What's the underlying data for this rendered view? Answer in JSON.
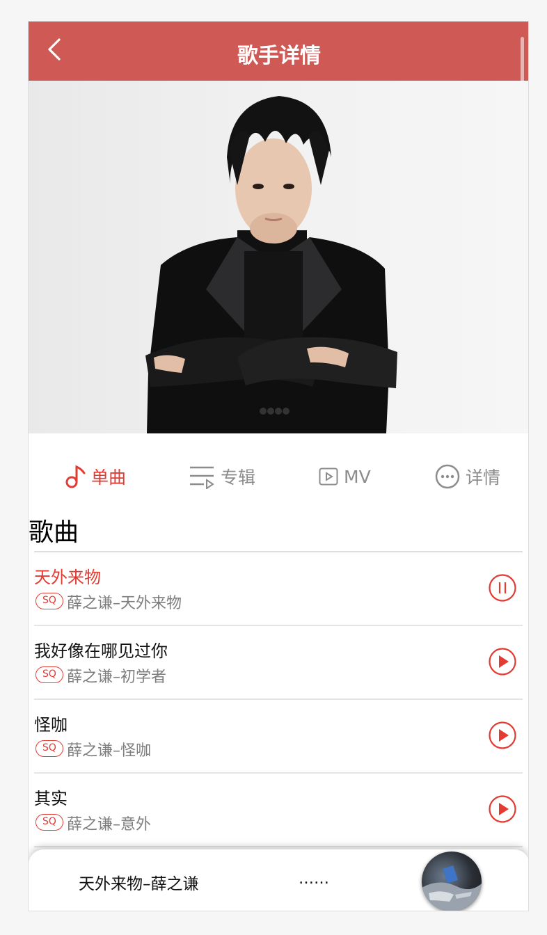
{
  "header": {
    "title": "歌手详情"
  },
  "tabs": [
    {
      "label": "单曲",
      "icon": "music-note-icon",
      "active": true
    },
    {
      "label": "专辑",
      "icon": "album-list-icon"
    },
    {
      "label": "MV",
      "icon": "video-icon"
    },
    {
      "label": "详情",
      "icon": "more-icon"
    }
  ],
  "section": {
    "title": "歌曲"
  },
  "songs": [
    {
      "name": "天外来物",
      "badge": "SQ",
      "meta": "薛之谦–天外来物",
      "state": "pause"
    },
    {
      "name": "我好像在哪见过你",
      "badge": "SQ",
      "meta": "薛之谦–初学者",
      "state": "play"
    },
    {
      "name": "怪咖",
      "badge": "SQ",
      "meta": "薛之谦–怪咖",
      "state": "play"
    },
    {
      "name": "其实",
      "badge": "SQ",
      "meta": "薛之谦–意外",
      "state": "play"
    }
  ],
  "player": {
    "now_playing": "天外来物–薛之谦",
    "lyric": "……"
  },
  "colors": {
    "header": "#cf5a55",
    "accent": "#e23b32",
    "muted": "#8c8c8c"
  }
}
